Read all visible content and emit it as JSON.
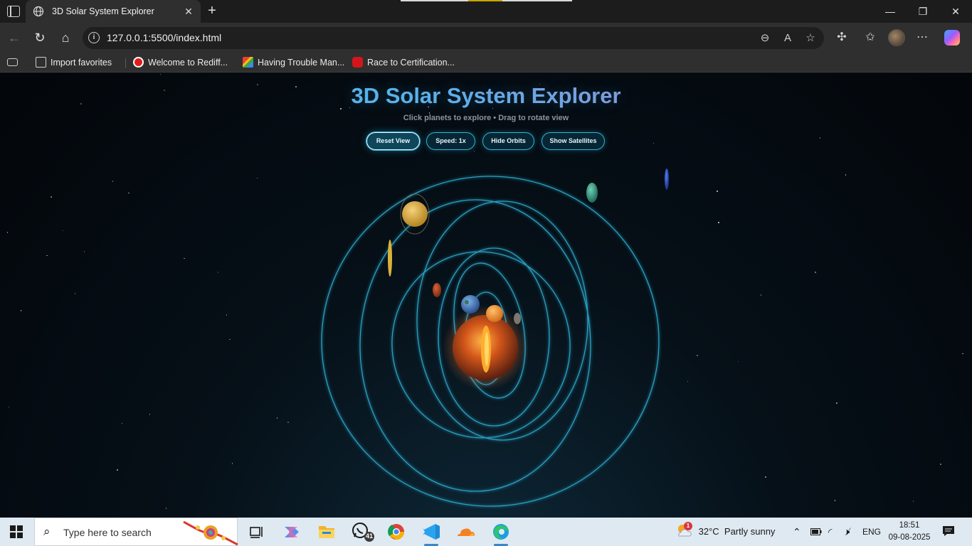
{
  "browser": {
    "tab_title": "3D Solar System Explorer",
    "url": "127.0.0.1:5500/index.html",
    "favorites": [
      {
        "label": "Import favorites"
      },
      {
        "label": "Welcome to Rediff..."
      },
      {
        "label": "Having Trouble Man..."
      },
      {
        "label": "Race to Certification..."
      }
    ]
  },
  "app": {
    "title": "3D Solar System Explorer",
    "subtitle": "Click planets to explore • Drag to rotate view",
    "controls": {
      "reset": "Reset View",
      "speed": "Speed: 1x",
      "orbits": "Hide Orbits",
      "satellites": "Show Satellites"
    }
  },
  "taskbar": {
    "search_placeholder": "Type here to search",
    "whatsapp_badge": "41",
    "weather_badge": "1",
    "weather": "32°C  Partly sunny",
    "language": "ENG",
    "time": "18:51",
    "date": "09-08-2025"
  },
  "colors": {
    "accent": "#2ab6d6",
    "title_gradient_start": "#35c3f0",
    "title_gradient_end": "#c28ecf",
    "sun": "#e26a1c",
    "background": "#03060a"
  }
}
